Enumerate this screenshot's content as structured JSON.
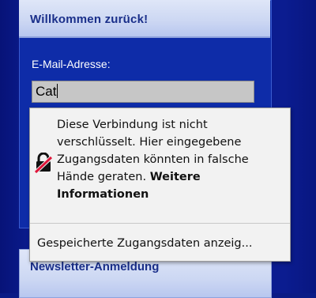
{
  "login": {
    "title": "Willkommen zurück!",
    "email_label": "E-Mail-Adresse:",
    "email_value": "Cat"
  },
  "newsletter": {
    "title": "Newsletter-Anmeldung"
  },
  "popup": {
    "warning_text": "Diese Verbindung ist nicht verschlüsselt. Hier eingegebene Zugangsdaten könnten in falsche Hände geraten.",
    "more_info_link": "Weitere Informationen",
    "saved_logins_label": "Gespeicherte Zugangsdaten anzeig...",
    "icon": "insecure-lock-icon"
  },
  "colors": {
    "page_background": "#0a1b86",
    "panel_header": "#cdd8f3",
    "header_text": "#1a2f8a",
    "popup_background": "#f2f2f2",
    "warning_strike": "#e0173b"
  }
}
